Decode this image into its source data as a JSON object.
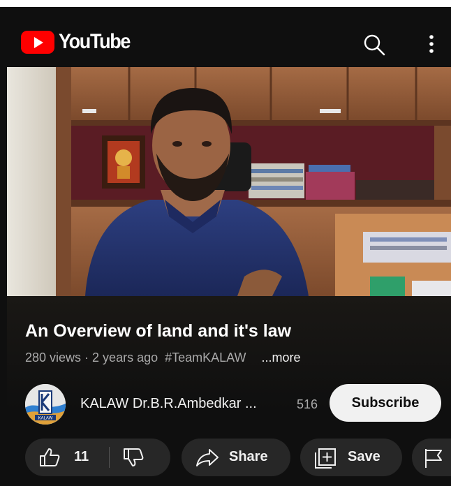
{
  "header": {
    "logo_text": "YouTube"
  },
  "video": {
    "title": "An Overview of land and it's law",
    "views": "280 views",
    "age": "2 years ago",
    "hashtag": "#TeamKALAW",
    "more_label": "...more"
  },
  "channel": {
    "name": "KALAW Dr.B.R.Ambedkar ...",
    "subscribers": "516",
    "subscribe_label": "Subscribe",
    "avatar_text": "KALAW"
  },
  "actions": {
    "like_count": "11",
    "share_label": "Share",
    "save_label": "Save"
  },
  "colors": {
    "background": "#0f0f0f",
    "brand_red": "#ff0000",
    "pill": "#272727",
    "subscribe_bg": "#f1f1f1"
  },
  "icons": [
    "youtube-logo-icon",
    "search-icon",
    "more-vert-icon",
    "thumb-up-icon",
    "thumb-down-icon",
    "share-icon",
    "save-playlist-icon",
    "report-flag-icon"
  ]
}
